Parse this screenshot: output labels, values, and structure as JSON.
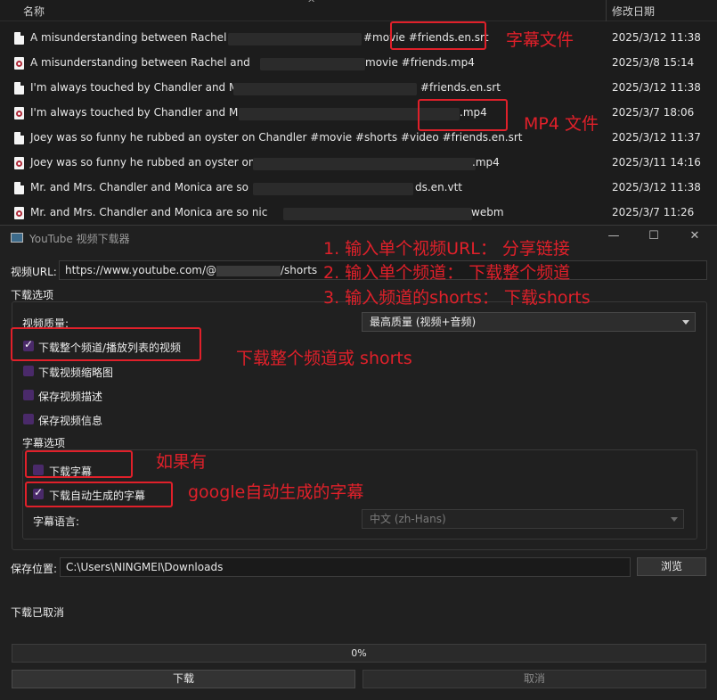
{
  "explorer": {
    "col_name": "名称",
    "col_date": "修改日期",
    "sort_glyph": "^",
    "files": [
      {
        "name": "A misunderstanding between Rachel a",
        "ext": "#movie #friends.en.srt",
        "date": "2025/3/12 11:38",
        "kind": "doc-icon"
      },
      {
        "name": "A misunderstanding between Rachel and",
        "ext": "movie #friends.mp4",
        "date": "2025/3/8 15:14",
        "kind": "video-icon"
      },
      {
        "name": "I'm always touched by Chandler and M",
        "ext": "#friends.en.srt",
        "date": "2025/3/12 11:38",
        "kind": "doc-icon"
      },
      {
        "name": "I'm always touched by Chandler and Mo",
        "ext": ".mp4",
        "date": "2025/3/7 18:06",
        "kind": "video-icon"
      },
      {
        "name": "Joey was so funny he rubbed an oyster on Chandler #movie #shorts #video #friends.en.srt",
        "ext": "",
        "date": "2025/3/12 11:37",
        "kind": "doc-icon"
      },
      {
        "name": "Joey was so funny he rubbed an oyster on",
        "ext": ".mp4",
        "date": "2025/3/11 14:16",
        "kind": "video-icon"
      },
      {
        "name": "Mr. and Mrs. Chandler and Monica are so",
        "ext": "ds.en.vtt",
        "date": "2025/3/12 11:38",
        "kind": "doc-icon"
      },
      {
        "name": "Mr. and Mrs. Chandler and Monica are so nic",
        "ext": "webm",
        "date": "2025/3/7 11:26",
        "kind": "video-icon"
      }
    ]
  },
  "window": {
    "title": "YouTube 视频下载器",
    "minimize": "—",
    "maximize": "☐",
    "close": "✕",
    "url_label": "视频URL:",
    "url_value": "https://www.youtube.com/@",
    "url_value_tail": "/shorts",
    "download_options_label": "下载选项",
    "quality_label": "视频质量:",
    "quality_value": "最高质量 (视频+音频)",
    "options": [
      {
        "label": "下载整个频道/播放列表的视频",
        "checked": true
      },
      {
        "label": "下载视频缩略图",
        "checked": false
      },
      {
        "label": "保存视频描述",
        "checked": false
      },
      {
        "label": "保存视频信息",
        "checked": false
      }
    ],
    "subtitle_group_label": "字幕选项",
    "subtitle_options": [
      {
        "label": "下载字幕",
        "checked": false
      },
      {
        "label": "下载自动生成的字幕",
        "checked": true
      }
    ],
    "subtitle_lang_label": "字幕语言:",
    "subtitle_lang_value": "中文 (zh-Hans)",
    "save_label": "保存位置:",
    "save_value": "C:\\Users\\NINGMEI\\Downloads",
    "browse_label": "浏览",
    "status": "下载已取消",
    "progress": 0,
    "progress_text": "0%",
    "download_button": "下载",
    "cancel_button": "取消"
  },
  "annotations": {
    "subtitle_file": "字幕文件",
    "mp4_file": "MP4 文件",
    "line1": "1. 输入单个视频URL：  分享链接",
    "line2": "2. 输入单个频道：   下载整个频道",
    "line3": "3. 输入频道的shorts：  下载shorts",
    "whole_channel": "下载整个频道或 shorts",
    "if_exists": "如果有",
    "google_auto": "google自动生成的字幕"
  },
  "colors": {
    "annotation": "#e0202a",
    "checkbox": "#4a2a6a",
    "background": "#202020"
  }
}
